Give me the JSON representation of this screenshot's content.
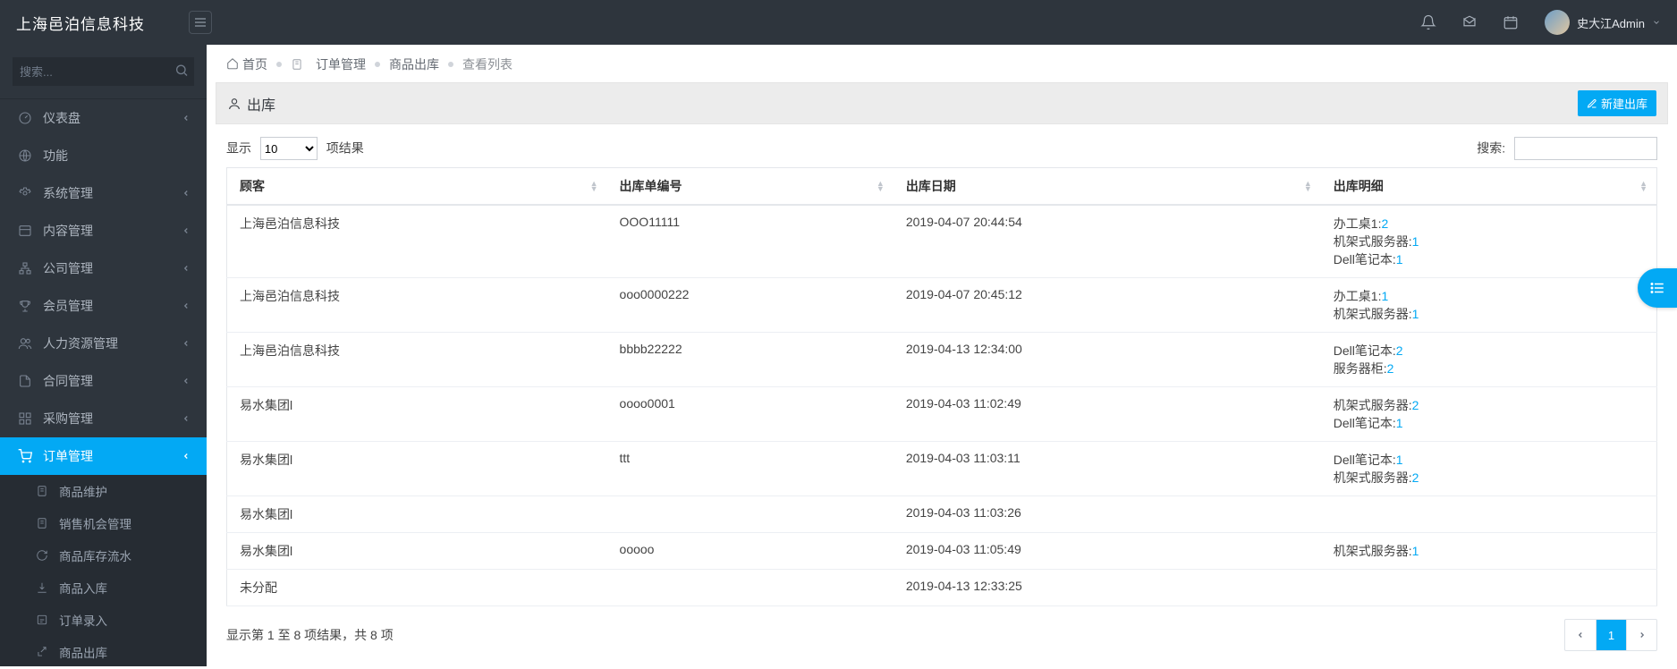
{
  "header": {
    "brand": "上海邑泊信息科技",
    "user_name": "史大江Admin"
  },
  "sidebar": {
    "search_placeholder": "搜索...",
    "items": [
      {
        "icon": "dashboard",
        "label": "仪表盘",
        "hasChildren": true
      },
      {
        "icon": "globe",
        "label": "功能",
        "hasChildren": false
      },
      {
        "icon": "cog",
        "label": "系统管理",
        "hasChildren": true
      },
      {
        "icon": "layout",
        "label": "内容管理",
        "hasChildren": true
      },
      {
        "icon": "sitemap",
        "label": "公司管理",
        "hasChildren": true
      },
      {
        "icon": "trophy",
        "label": "会员管理",
        "hasChildren": true
      },
      {
        "icon": "users",
        "label": "人力资源管理",
        "hasChildren": true
      },
      {
        "icon": "file",
        "label": "合同管理",
        "hasChildren": true
      },
      {
        "icon": "grid",
        "label": "采购管理",
        "hasChildren": true
      }
    ],
    "active": {
      "icon": "cart",
      "label": "订单管理"
    },
    "sub_items": [
      {
        "icon": "doc",
        "label": "商品维护"
      },
      {
        "icon": "doc",
        "label": "销售机会管理"
      },
      {
        "icon": "refresh",
        "label": "商品库存流水"
      },
      {
        "icon": "in",
        "label": "商品入库"
      },
      {
        "icon": "edit",
        "label": "订单录入"
      },
      {
        "icon": "out",
        "label": "商品出库"
      }
    ]
  },
  "breadcrumb": {
    "home": "首页",
    "items": [
      "订单管理",
      "商品出库",
      "查看列表"
    ]
  },
  "panel": {
    "title": "出库",
    "new_button": "新建出库"
  },
  "table_controls": {
    "show_label_prefix": "显示",
    "show_label_suffix": "项结果",
    "page_size": "10",
    "search_label": "搜索:"
  },
  "table": {
    "columns": [
      "顾客",
      "出库单编号",
      "出库日期",
      "出库明细"
    ],
    "rows": [
      {
        "customer": "上海邑泊信息科技",
        "code": "OOO11111",
        "date": "2019-04-07 20:44:54",
        "details": [
          {
            "name": "办工桌1",
            "qty": "2"
          },
          {
            "name": "机架式服务器",
            "qty": "1"
          },
          {
            "name": "Dell笔记本",
            "qty": "1"
          }
        ]
      },
      {
        "customer": "上海邑泊信息科技",
        "code": "ooo0000222",
        "date": "2019-04-07 20:45:12",
        "details": [
          {
            "name": "办工桌1",
            "qty": "1"
          },
          {
            "name": "机架式服务器",
            "qty": "1"
          }
        ]
      },
      {
        "customer": "上海邑泊信息科技",
        "code": "bbbb22222",
        "date": "2019-04-13 12:34:00",
        "details": [
          {
            "name": "Dell笔记本",
            "qty": "2"
          },
          {
            "name": "服务器柜",
            "qty": "2"
          }
        ]
      },
      {
        "customer": "易水集团l",
        "code": "oooo0001",
        "date": "2019-04-03 11:02:49",
        "details": [
          {
            "name": "机架式服务器",
            "qty": "2"
          },
          {
            "name": "Dell笔记本",
            "qty": "1"
          }
        ]
      },
      {
        "customer": "易水集团l",
        "code": "ttt",
        "date": "2019-04-03 11:03:11",
        "details": [
          {
            "name": "Dell笔记本",
            "qty": "1"
          },
          {
            "name": "机架式服务器",
            "qty": "2"
          }
        ]
      },
      {
        "customer": "易水集团l",
        "code": "",
        "date": "2019-04-03 11:03:26",
        "details": []
      },
      {
        "customer": "易水集团l",
        "code": "ooooo",
        "date": "2019-04-03 11:05:49",
        "details": [
          {
            "name": "机架式服务器",
            "qty": "1"
          }
        ]
      },
      {
        "customer": "未分配",
        "code": "",
        "date": "2019-04-13 12:33:25",
        "details": []
      }
    ]
  },
  "table_footer": {
    "info": "显示第 1 至 8 项结果，共 8 项",
    "page": "1"
  }
}
